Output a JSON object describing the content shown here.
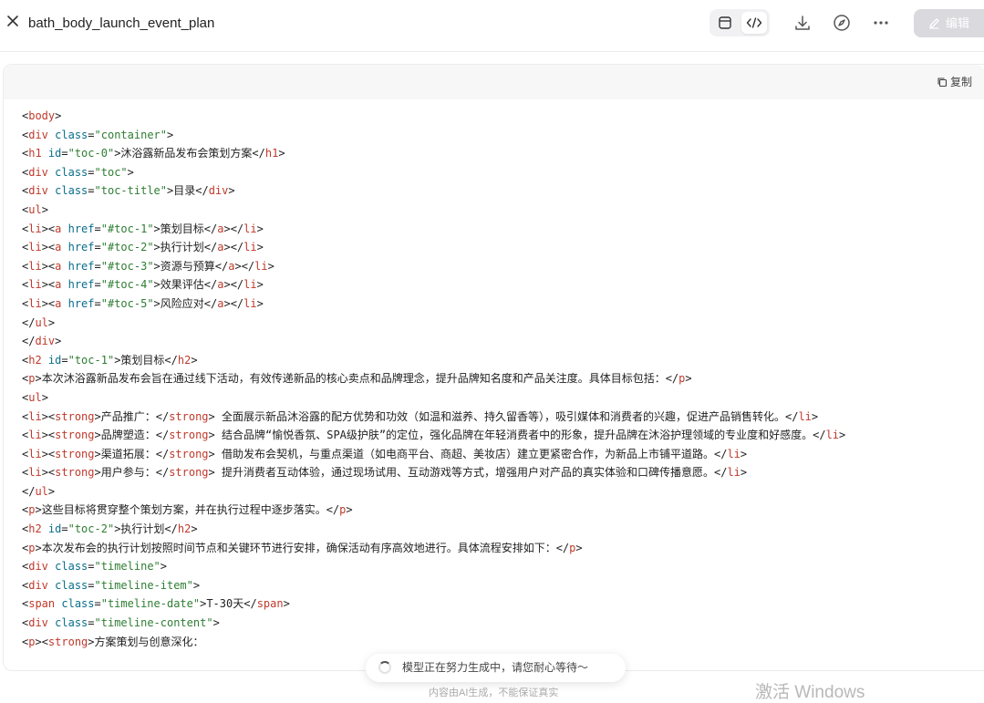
{
  "header": {
    "title": "bath_body_launch_event_plan",
    "edit_label": "编辑"
  },
  "panel": {
    "copy_label": "复制"
  },
  "code_lines": [
    [
      [
        "t",
        "<"
      ],
      [
        "g",
        "body"
      ],
      [
        "t",
        ">"
      ]
    ],
    [
      [
        "t",
        "<"
      ],
      [
        "g",
        "div"
      ],
      [
        "t",
        " "
      ],
      [
        "a",
        "class"
      ],
      [
        "t",
        "="
      ],
      [
        "s",
        "\"container\""
      ],
      [
        "t",
        ">"
      ]
    ],
    [
      [
        "t",
        "<"
      ],
      [
        "g",
        "h1"
      ],
      [
        "t",
        " "
      ],
      [
        "a",
        "id"
      ],
      [
        "t",
        "="
      ],
      [
        "s",
        "\"toc-0\""
      ],
      [
        "t",
        ">沐浴露新品发布会策划方案</"
      ],
      [
        "g",
        "h1"
      ],
      [
        "t",
        ">"
      ]
    ],
    [
      [
        "t",
        "<"
      ],
      [
        "g",
        "div"
      ],
      [
        "t",
        " "
      ],
      [
        "a",
        "class"
      ],
      [
        "t",
        "="
      ],
      [
        "s",
        "\"toc\""
      ],
      [
        "t",
        ">"
      ]
    ],
    [
      [
        "t",
        "<"
      ],
      [
        "g",
        "div"
      ],
      [
        "t",
        " "
      ],
      [
        "a",
        "class"
      ],
      [
        "t",
        "="
      ],
      [
        "s",
        "\"toc-title\""
      ],
      [
        "t",
        ">目录</"
      ],
      [
        "g",
        "div"
      ],
      [
        "t",
        ">"
      ]
    ],
    [
      [
        "t",
        "<"
      ],
      [
        "g",
        "ul"
      ],
      [
        "t",
        ">"
      ]
    ],
    [
      [
        "t",
        "<"
      ],
      [
        "g",
        "li"
      ],
      [
        "t",
        "><"
      ],
      [
        "g",
        "a"
      ],
      [
        "t",
        " "
      ],
      [
        "a",
        "href"
      ],
      [
        "t",
        "="
      ],
      [
        "s",
        "\"#toc-1\""
      ],
      [
        "t",
        ">策划目标</"
      ],
      [
        "g",
        "a"
      ],
      [
        "t",
        "></"
      ],
      [
        "g",
        "li"
      ],
      [
        "t",
        ">"
      ]
    ],
    [
      [
        "t",
        "<"
      ],
      [
        "g",
        "li"
      ],
      [
        "t",
        "><"
      ],
      [
        "g",
        "a"
      ],
      [
        "t",
        " "
      ],
      [
        "a",
        "href"
      ],
      [
        "t",
        "="
      ],
      [
        "s",
        "\"#toc-2\""
      ],
      [
        "t",
        ">执行计划</"
      ],
      [
        "g",
        "a"
      ],
      [
        "t",
        "></"
      ],
      [
        "g",
        "li"
      ],
      [
        "t",
        ">"
      ]
    ],
    [
      [
        "t",
        "<"
      ],
      [
        "g",
        "li"
      ],
      [
        "t",
        "><"
      ],
      [
        "g",
        "a"
      ],
      [
        "t",
        " "
      ],
      [
        "a",
        "href"
      ],
      [
        "t",
        "="
      ],
      [
        "s",
        "\"#toc-3\""
      ],
      [
        "t",
        ">资源与预算</"
      ],
      [
        "g",
        "a"
      ],
      [
        "t",
        "></"
      ],
      [
        "g",
        "li"
      ],
      [
        "t",
        ">"
      ]
    ],
    [
      [
        "t",
        "<"
      ],
      [
        "g",
        "li"
      ],
      [
        "t",
        "><"
      ],
      [
        "g",
        "a"
      ],
      [
        "t",
        " "
      ],
      [
        "a",
        "href"
      ],
      [
        "t",
        "="
      ],
      [
        "s",
        "\"#toc-4\""
      ],
      [
        "t",
        ">效果评估</"
      ],
      [
        "g",
        "a"
      ],
      [
        "t",
        "></"
      ],
      [
        "g",
        "li"
      ],
      [
        "t",
        ">"
      ]
    ],
    [
      [
        "t",
        "<"
      ],
      [
        "g",
        "li"
      ],
      [
        "t",
        "><"
      ],
      [
        "g",
        "a"
      ],
      [
        "t",
        " "
      ],
      [
        "a",
        "href"
      ],
      [
        "t",
        "="
      ],
      [
        "s",
        "\"#toc-5\""
      ],
      [
        "t",
        ">风险应对</"
      ],
      [
        "g",
        "a"
      ],
      [
        "t",
        "></"
      ],
      [
        "g",
        "li"
      ],
      [
        "t",
        ">"
      ]
    ],
    [
      [
        "t",
        "</"
      ],
      [
        "g",
        "ul"
      ],
      [
        "t",
        ">"
      ]
    ],
    [
      [
        "t",
        "</"
      ],
      [
        "g",
        "div"
      ],
      [
        "t",
        ">"
      ]
    ],
    [
      [
        "t",
        "<"
      ],
      [
        "g",
        "h2"
      ],
      [
        "t",
        " "
      ],
      [
        "a",
        "id"
      ],
      [
        "t",
        "="
      ],
      [
        "s",
        "\"toc-1\""
      ],
      [
        "t",
        ">策划目标</"
      ],
      [
        "g",
        "h2"
      ],
      [
        "t",
        ">"
      ]
    ],
    [
      [
        "t",
        "<"
      ],
      [
        "g",
        "p"
      ],
      [
        "t",
        ">本次沐浴露新品发布会旨在通过线下活动，有效传递新品的核心卖点和品牌理念，提升品牌知名度和产品关注度。具体目标包括：</"
      ],
      [
        "g",
        "p"
      ],
      [
        "t",
        ">"
      ]
    ],
    [
      [
        "t",
        "<"
      ],
      [
        "g",
        "ul"
      ],
      [
        "t",
        ">"
      ]
    ],
    [
      [
        "t",
        "<"
      ],
      [
        "g",
        "li"
      ],
      [
        "t",
        "><"
      ],
      [
        "g",
        "strong"
      ],
      [
        "t",
        ">产品推广：</"
      ],
      [
        "g",
        "strong"
      ],
      [
        "t",
        "> 全面展示新品沐浴露的配方优势和功效（如温和滋养、持久留香等），吸引媒体和消费者的兴趣，促进产品销售转化。</"
      ],
      [
        "g",
        "li"
      ],
      [
        "t",
        ">"
      ]
    ],
    [
      [
        "t",
        "<"
      ],
      [
        "g",
        "li"
      ],
      [
        "t",
        "><"
      ],
      [
        "g",
        "strong"
      ],
      [
        "t",
        ">品牌塑造：</"
      ],
      [
        "g",
        "strong"
      ],
      [
        "t",
        "> 结合品牌“愉悦香氛、SPA级护肤”的定位，强化品牌在年轻消费者中的形象，提升品牌在沐浴护理领域的专业度和好感度。</"
      ],
      [
        "g",
        "li"
      ],
      [
        "t",
        ">"
      ]
    ],
    [
      [
        "t",
        "<"
      ],
      [
        "g",
        "li"
      ],
      [
        "t",
        "><"
      ],
      [
        "g",
        "strong"
      ],
      [
        "t",
        ">渠道拓展：</"
      ],
      [
        "g",
        "strong"
      ],
      [
        "t",
        "> 借助发布会契机，与重点渠道（如电商平台、商超、美妆店）建立更紧密合作，为新品上市铺平道路。</"
      ],
      [
        "g",
        "li"
      ],
      [
        "t",
        ">"
      ]
    ],
    [
      [
        "t",
        "<"
      ],
      [
        "g",
        "li"
      ],
      [
        "t",
        "><"
      ],
      [
        "g",
        "strong"
      ],
      [
        "t",
        ">用户参与：</"
      ],
      [
        "g",
        "strong"
      ],
      [
        "t",
        "> 提升消费者互动体验，通过现场试用、互动游戏等方式，增强用户对产品的真实体验和口碑传播意愿。</"
      ],
      [
        "g",
        "li"
      ],
      [
        "t",
        ">"
      ]
    ],
    [
      [
        "t",
        "</"
      ],
      [
        "g",
        "ul"
      ],
      [
        "t",
        ">"
      ]
    ],
    [
      [
        "t",
        "<"
      ],
      [
        "g",
        "p"
      ],
      [
        "t",
        ">这些目标将贯穿整个策划方案，并在执行过程中逐步落实。</"
      ],
      [
        "g",
        "p"
      ],
      [
        "t",
        ">"
      ]
    ],
    [
      [
        "t",
        "<"
      ],
      [
        "g",
        "h2"
      ],
      [
        "t",
        " "
      ],
      [
        "a",
        "id"
      ],
      [
        "t",
        "="
      ],
      [
        "s",
        "\"toc-2\""
      ],
      [
        "t",
        ">执行计划</"
      ],
      [
        "g",
        "h2"
      ],
      [
        "t",
        ">"
      ]
    ],
    [
      [
        "t",
        "<"
      ],
      [
        "g",
        "p"
      ],
      [
        "t",
        ">本次发布会的执行计划按照时间节点和关键环节进行安排，确保活动有序高效地进行。具体流程安排如下：</"
      ],
      [
        "g",
        "p"
      ],
      [
        "t",
        ">"
      ]
    ],
    [
      [
        "t",
        "<"
      ],
      [
        "g",
        "div"
      ],
      [
        "t",
        " "
      ],
      [
        "a",
        "class"
      ],
      [
        "t",
        "="
      ],
      [
        "s",
        "\"timeline\""
      ],
      [
        "t",
        ">"
      ]
    ],
    [
      [
        "t",
        "<"
      ],
      [
        "g",
        "div"
      ],
      [
        "t",
        " "
      ],
      [
        "a",
        "class"
      ],
      [
        "t",
        "="
      ],
      [
        "s",
        "\"timeline-item\""
      ],
      [
        "t",
        ">"
      ]
    ],
    [
      [
        "t",
        "<"
      ],
      [
        "g",
        "span"
      ],
      [
        "t",
        " "
      ],
      [
        "a",
        "class"
      ],
      [
        "t",
        "="
      ],
      [
        "s",
        "\"timeline-date\""
      ],
      [
        "t",
        ">T-30天</"
      ],
      [
        "g",
        "span"
      ],
      [
        "t",
        ">"
      ]
    ],
    [
      [
        "t",
        "<"
      ],
      [
        "g",
        "div"
      ],
      [
        "t",
        " "
      ],
      [
        "a",
        "class"
      ],
      [
        "t",
        "="
      ],
      [
        "s",
        "\"timeline-content\""
      ],
      [
        "t",
        ">"
      ]
    ],
    [
      [
        "t",
        "<"
      ],
      [
        "g",
        "p"
      ],
      [
        "t",
        "><"
      ],
      [
        "g",
        "strong"
      ],
      [
        "t",
        ">方案策划与创意深化："
      ]
    ]
  ],
  "status": {
    "loading_text": "模型正在努力生成中，请您耐心等待～",
    "disclaimer": "内容由AI生成，不能保证真实",
    "watermark": "激活 Windows"
  }
}
